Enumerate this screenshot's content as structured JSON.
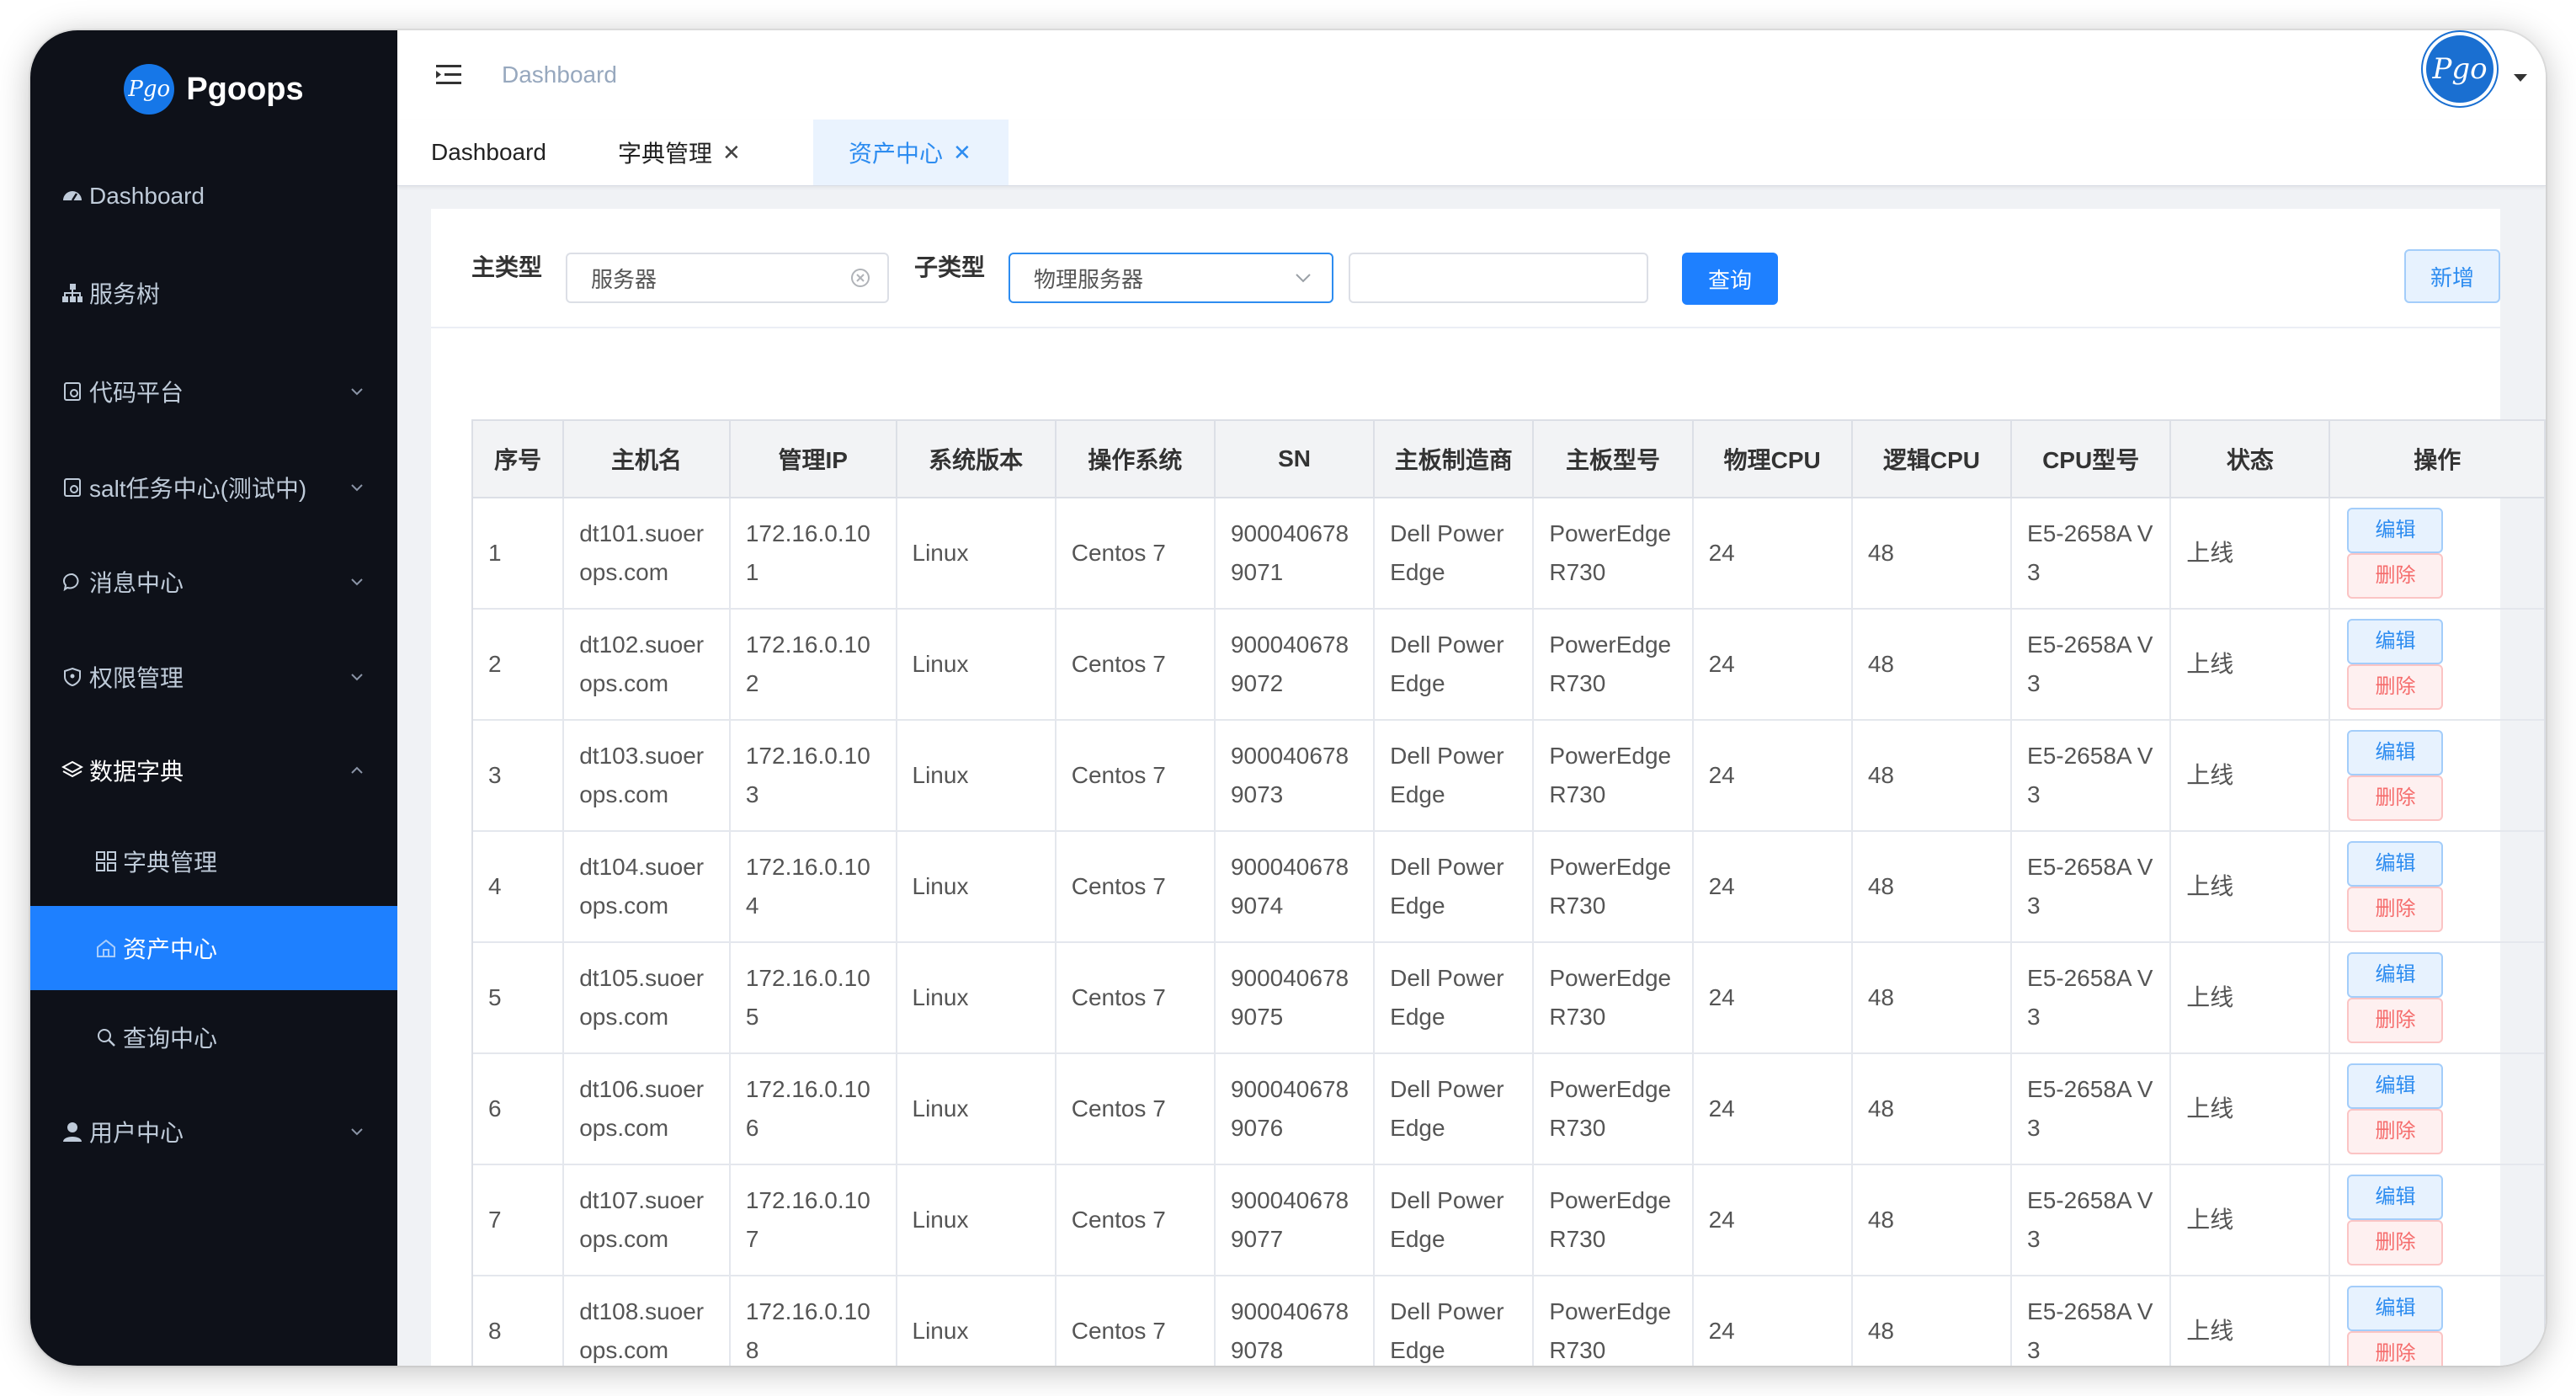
{
  "brand": {
    "name": "Pgoops",
    "logo_text": "Pgo"
  },
  "sidebar": {
    "items": [
      {
        "label": "Dashboard",
        "icon": "dashboard-icon"
      },
      {
        "label": "服务树",
        "icon": "sitemap-icon"
      },
      {
        "label": "代码平台",
        "icon": "document-icon"
      },
      {
        "label": "salt任务中心(测试中)",
        "icon": "document-icon"
      },
      {
        "label": "消息中心",
        "icon": "chat-icon"
      },
      {
        "label": "权限管理",
        "icon": "shield-icon"
      },
      {
        "label": "数据字典",
        "icon": "layers-icon"
      },
      {
        "label": "用户中心",
        "icon": "user-icon"
      }
    ],
    "submenu": [
      {
        "label": "字典管理",
        "icon": "grid-icon"
      },
      {
        "label": "资产中心",
        "icon": "home-icon"
      },
      {
        "label": "查询中心",
        "icon": "search-icon"
      }
    ]
  },
  "header": {
    "breadcrumb": "Dashboard"
  },
  "tags": [
    {
      "label": "Dashboard"
    },
    {
      "label": "字典管理"
    },
    {
      "label": "资产中心"
    }
  ],
  "filter": {
    "main_type_label": "主类型",
    "main_type_value": "服务器",
    "sub_type_label": "子类型",
    "sub_type_value": "物理服务器",
    "search_value": "",
    "query_button": "查询",
    "add_button": "新增"
  },
  "table": {
    "headers": [
      "序号",
      "主机名",
      "管理IP",
      "系统版本",
      "操作系统",
      "SN",
      "主板制造商",
      "主板型号",
      "物理CPU",
      "逻辑CPU",
      "CPU型号",
      "状态",
      "操作"
    ],
    "edit_label": "编辑",
    "delete_label": "删除",
    "rows": [
      [
        "1",
        "dt101.suoerops.com",
        "172.16.0.101",
        "Linux",
        "Centos 7",
        "9000406789071",
        "Dell PowerEdge",
        "PowerEdge R730",
        "24",
        "48",
        "E5-2658A V3",
        "上线"
      ],
      [
        "2",
        "dt102.suoerops.com",
        "172.16.0.102",
        "Linux",
        "Centos 7",
        "9000406789072",
        "Dell PowerEdge",
        "PowerEdge R730",
        "24",
        "48",
        "E5-2658A V3",
        "上线"
      ],
      [
        "3",
        "dt103.suoerops.com",
        "172.16.0.103",
        "Linux",
        "Centos 7",
        "9000406789073",
        "Dell PowerEdge",
        "PowerEdge R730",
        "24",
        "48",
        "E5-2658A V3",
        "上线"
      ],
      [
        "4",
        "dt104.suoerops.com",
        "172.16.0.104",
        "Linux",
        "Centos 7",
        "9000406789074",
        "Dell PowerEdge",
        "PowerEdge R730",
        "24",
        "48",
        "E5-2658A V3",
        "上线"
      ],
      [
        "5",
        "dt105.suoerops.com",
        "172.16.0.105",
        "Linux",
        "Centos 7",
        "9000406789075",
        "Dell PowerEdge",
        "PowerEdge R730",
        "24",
        "48",
        "E5-2658A V3",
        "上线"
      ],
      [
        "6",
        "dt106.suoerops.com",
        "172.16.0.106",
        "Linux",
        "Centos 7",
        "9000406789076",
        "Dell PowerEdge",
        "PowerEdge R730",
        "24",
        "48",
        "E5-2658A V3",
        "上线"
      ],
      [
        "7",
        "dt107.suoerops.com",
        "172.16.0.107",
        "Linux",
        "Centos 7",
        "9000406789077",
        "Dell PowerEdge",
        "PowerEdge R730",
        "24",
        "48",
        "E5-2658A V3",
        "上线"
      ],
      [
        "8",
        "dt108.suoerops.com",
        "172.16.0.108",
        "Linux",
        "Centos 7",
        "9000406789078",
        "Dell PowerEdge",
        "PowerEdge R730",
        "24",
        "48",
        "E5-2658A V3",
        "上线"
      ]
    ]
  },
  "colors": {
    "sidebar_bg": "#0e1119",
    "accent": "#1e80ff",
    "danger": "#f56c6c"
  }
}
